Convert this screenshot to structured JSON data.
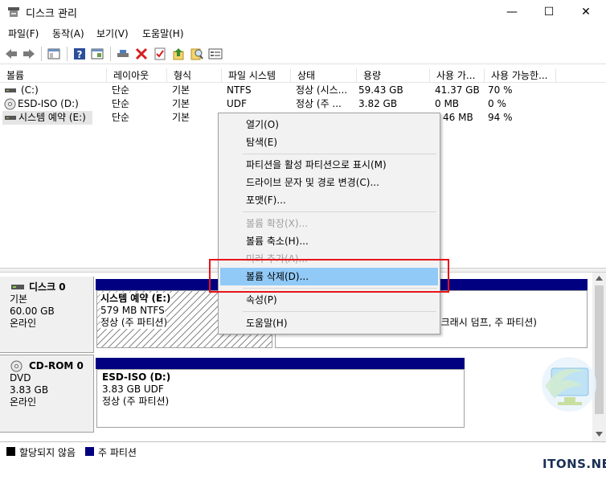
{
  "window": {
    "title": "디스크 관리",
    "minimize": "—",
    "maximize": "☐",
    "close": "✕"
  },
  "menu": [
    "파일(F)",
    "동작(A)",
    "보기(V)",
    "도움말(H)"
  ],
  "toolbar_icons": [
    "back-arrow-icon",
    "forward-arrow-icon",
    "properties-pane-icon",
    "help-icon",
    "console-icon",
    "connect-drive-icon",
    "delete-x-icon",
    "check-icon",
    "up-arrow-icon",
    "search-icon",
    "settings-list-icon"
  ],
  "table": {
    "columns": [
      "볼륨",
      "레이아웃",
      "형식",
      "파일 시스템",
      "상태",
      "용량",
      "사용 가...",
      "사용 가능한..."
    ],
    "rows": [
      {
        "icon": "drive-icon",
        "volume": "(C:)",
        "layout": "단순",
        "type": "기본",
        "fs": "NTFS",
        "status": "정상 (시스...",
        "capacity": "59.43 GB",
        "free": "41.37 GB",
        "free_pct": "70 %"
      },
      {
        "icon": "cd-icon",
        "volume": "ESD-ISO (D:)",
        "layout": "단순",
        "type": "기본",
        "fs": "UDF",
        "status": "정상 (주 ...",
        "capacity": "3.82 GB",
        "free": "0 MB",
        "free_pct": "0 %"
      },
      {
        "icon": "drive-icon",
        "volume": "시스템 예약 (E:)",
        "layout": "단순",
        "type": "기본",
        "fs": "",
        "status": "",
        "capacity": "",
        "free": "46 MB",
        "free_pct": "94 %"
      }
    ]
  },
  "disks": [
    {
      "name": "디스크 0",
      "type": "기본",
      "size": "60.00 GB",
      "state": "온라인",
      "partitions": [
        {
          "name": "시스템 예약  (E:)",
          "size": "579 MB NTFS",
          "status": "정상 (주 파티션)"
        },
        {
          "status_tail": ", 크래시 덤프, 주 파티션)"
        }
      ]
    },
    {
      "name": "CD-ROM 0",
      "type": "DVD",
      "size": "3.83 GB",
      "state": "온라인",
      "partitions": [
        {
          "name": "ESD-ISO  (D:)",
          "size": "3.83 GB UDF",
          "status": "정상 (주 파티션)"
        }
      ]
    }
  ],
  "legend": [
    {
      "label": "할당되지 않음",
      "color": "#000000"
    },
    {
      "label": "주 파티션",
      "color": "#000080"
    }
  ],
  "context_menu": {
    "items": {
      "open": "열기(O)",
      "explore": "탐색(E)",
      "mark_active": "파티션을 활성 파티션으로 표시(M)",
      "change_letter": "드라이브 문자 및 경로 변경(C)...",
      "format": "포맷(F)...",
      "extend": "볼륨 확장(X)...",
      "shrink": "볼륨 축소(H)...",
      "add_mirror": "미러 추가(A)...",
      "delete": "볼륨 삭제(D)...",
      "properties": "속성(P)",
      "help": "도움말(H)"
    }
  },
  "watermark": "ITONS.NET",
  "colors": {
    "highlight": "#91c9f7",
    "annotation_red": "#e8141b",
    "primary_partition": "#000080"
  }
}
